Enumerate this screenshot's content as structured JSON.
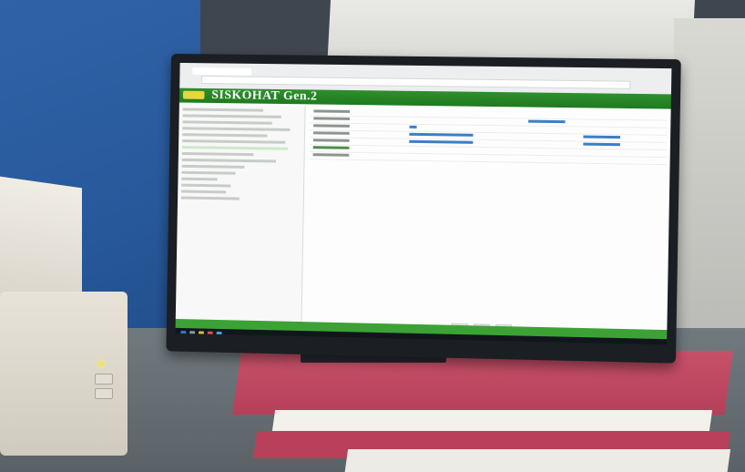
{
  "app": {
    "title": "SISKOHAT Gen.2"
  }
}
